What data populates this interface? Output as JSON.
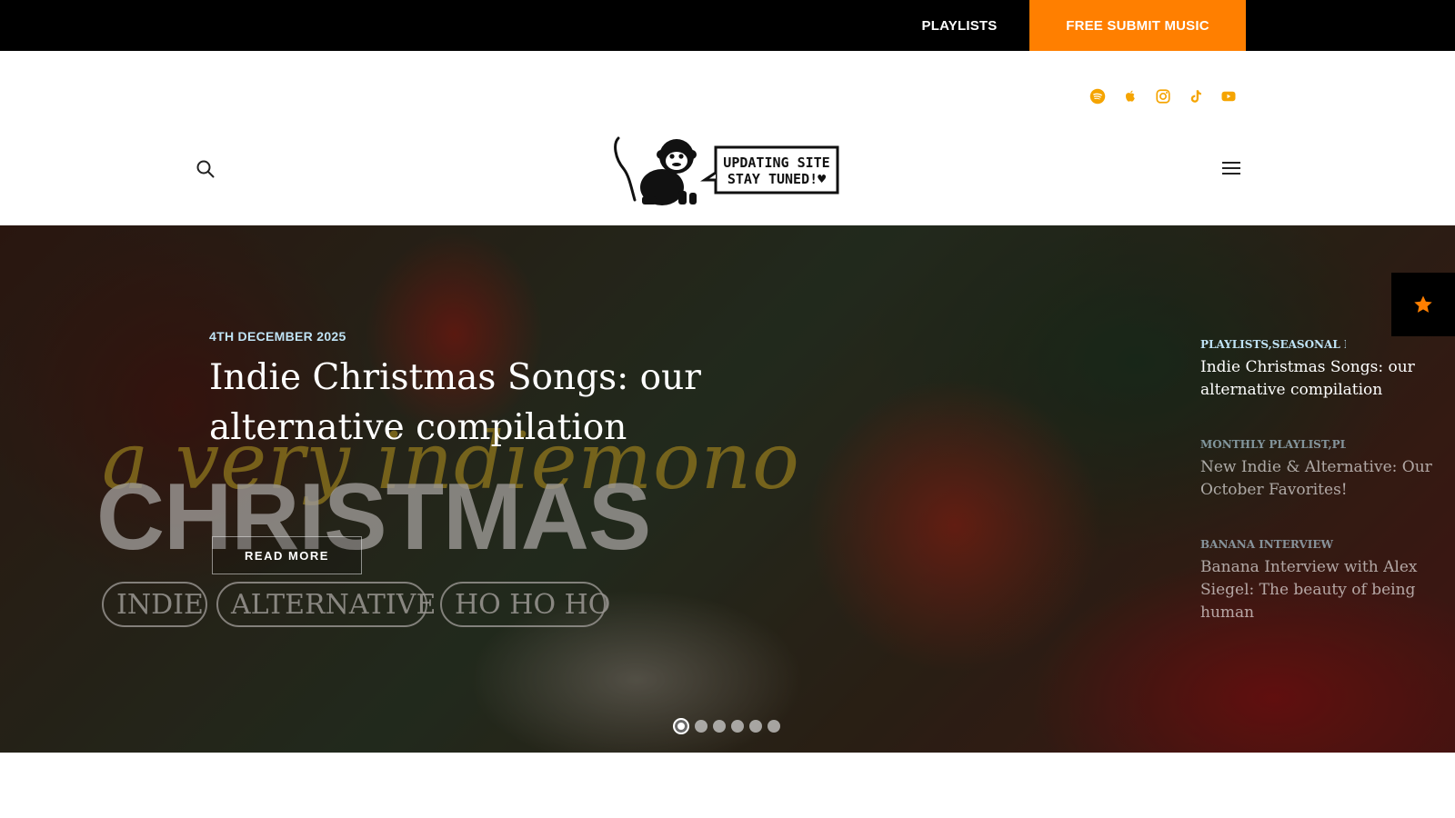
{
  "topbar": {
    "playlists_label": "PLAYLISTS",
    "submit_label": "FREE SUBMIT MUSIC",
    "submit_color": "#ff7f00"
  },
  "header": {
    "social_icons": [
      "spotify-icon",
      "apple-icon",
      "instagram-icon",
      "tiktok-icon",
      "youtube-icon"
    ],
    "social_color": "#f5a400",
    "logo": {
      "bubble_line_1": "UPDATING SITE",
      "bubble_line_2": "STAY TUNED!♥"
    }
  },
  "hero": {
    "date": "4TH DECEMBER 2025",
    "title": "Indie Christmas Songs: our alternative compilation",
    "read_more_label": "READ MORE",
    "artwork": {
      "script_text": "a very indiemono",
      "big_text": "CHRISTMAS",
      "pills": [
        "INDIE",
        "ALTERNATIVE",
        "HO HO HO"
      ]
    },
    "slide_count": 6,
    "active_slide": 1
  },
  "side_list": [
    {
      "category": "PLAYLISTS,SEASONAL P",
      "title": "Indie Christmas Songs: our alternative compilation"
    },
    {
      "category": "MONTHLY PLAYLIST,PLA",
      "title": "New Indie & Alternative: Our October Favorites!"
    },
    {
      "category": "BANANA INTERVIEW",
      "title": "Banana Interview with Alex Siegel: The beauty of being human"
    }
  ],
  "colors": {
    "accent": "#ff7f00",
    "date_color": "#bfe3f5"
  }
}
